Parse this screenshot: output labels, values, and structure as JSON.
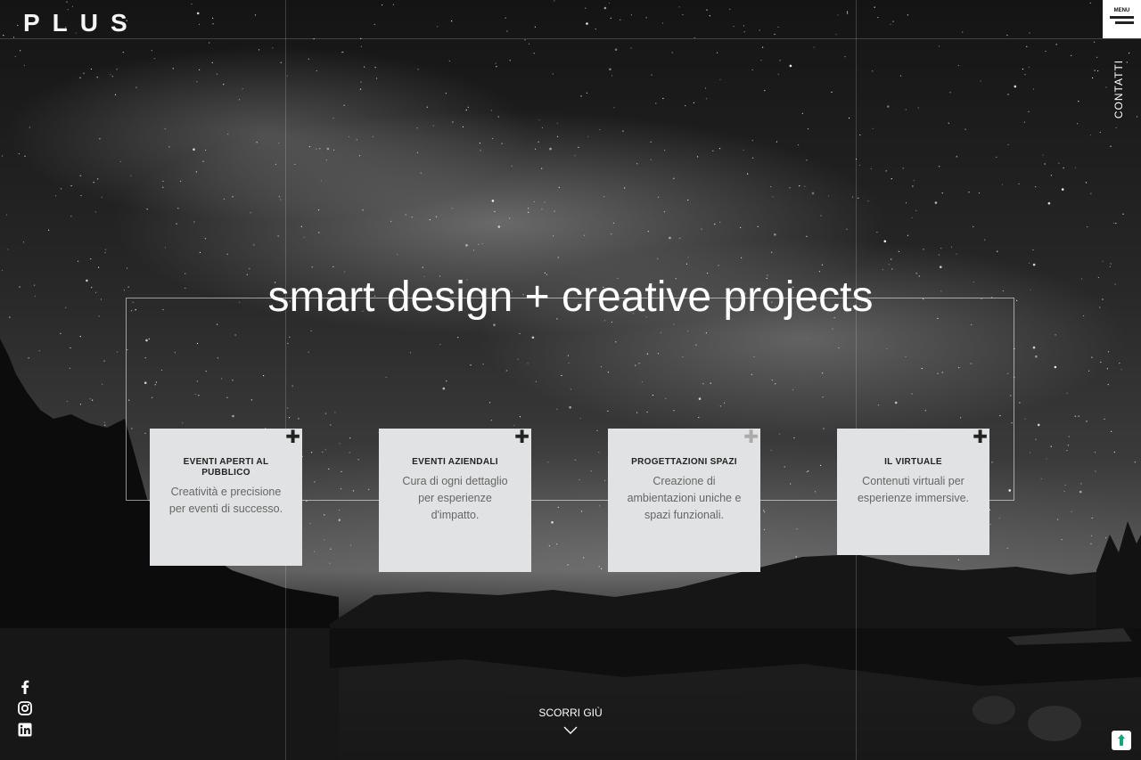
{
  "brand": {
    "logo_text": "PLUS"
  },
  "header": {
    "menu_label": "MENU",
    "contact_label": "CONTATTI"
  },
  "hero": {
    "headline": "smart design + creative projects"
  },
  "services": [
    {
      "title": "EVENTI APERTI AL PUBBLICO",
      "description": "Creatività e precisione per eventi di successo."
    },
    {
      "title": "EVENTI AZIENDALI",
      "description": "Cura di ogni dettaglio per esperienze d'impatto."
    },
    {
      "title": "PROGETTAZIONI SPAZI",
      "description": "Creazione di ambientazioni uniche e spazi funzionali."
    },
    {
      "title": "IL VIRTUALE",
      "description": "Contenuti virtuali per esperienze immersive."
    }
  ],
  "social": [
    {
      "icon": "facebook-icon"
    },
    {
      "icon": "instagram-icon"
    },
    {
      "icon": "linkedin-icon"
    }
  ],
  "scroll": {
    "label": "SCORRI GIÙ"
  },
  "colors": {
    "card_bg": "#e1e2e3",
    "menu_bg": "#ffffff",
    "badge_accent": "#1aa37a"
  }
}
